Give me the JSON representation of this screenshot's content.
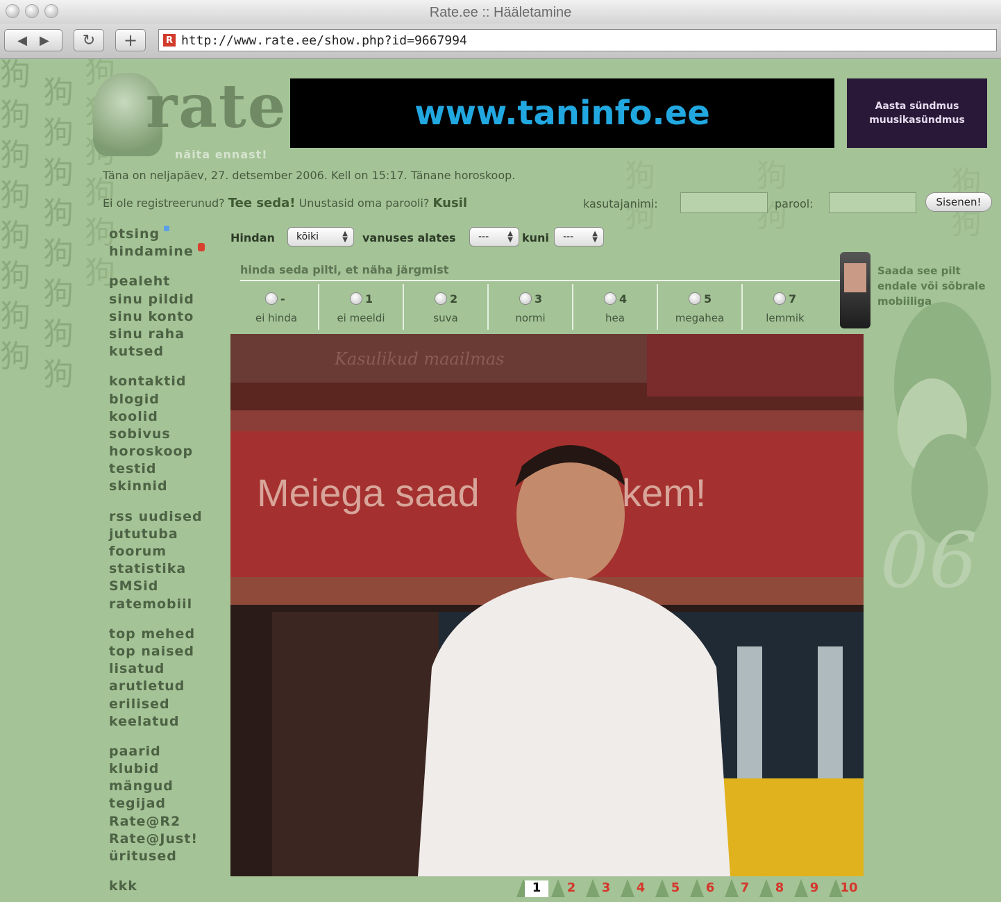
{
  "window": {
    "title": "Rate.ee :: Hääletamine"
  },
  "browser": {
    "url": "http://www.rate.ee/show.php?id=9667994"
  },
  "logo": {
    "text": "rate",
    "tagline": "näita ennast!"
  },
  "banner": {
    "text": "www.taninfo.ee"
  },
  "ad": {
    "line1": "Aasta sündmus",
    "line2": "muusikasündmus"
  },
  "dateline": "Täna on neljapäev, 27. detsember 2006. Kell on 15:17. Tänane horoskoop.",
  "register": {
    "question": "Ei ole registreerunud?",
    "link": "Tee seda!",
    "forgot": "Unustasid oma parooli?",
    "forgot_link": "Kusil",
    "username_label": "kasutajanimi:",
    "password_label": "parool:",
    "login_button": "Sisenen!"
  },
  "nav": {
    "group1": [
      "otsing",
      "hindamine"
    ],
    "group2": [
      "pealeht",
      "sinu pildid",
      "sinu konto",
      "sinu raha",
      "kutsed"
    ],
    "group3": [
      "kontaktid",
      "blogid",
      "koolid",
      "sobivus",
      "horoskoop",
      "testid",
      "skinnid"
    ],
    "group4": [
      "rss uudised",
      "jututuba",
      "foorum",
      "statistika",
      "SMSid",
      "ratemobiil"
    ],
    "group5": [
      "top mehed",
      "top naised",
      "lisatud",
      "arutletud",
      "erilised",
      "keelatud"
    ],
    "group6": [
      "paarid",
      "klubid",
      "mängud",
      "tegijad",
      "Rate@R2",
      "Rate@Just!",
      "üritused"
    ],
    "group7": [
      "kkk"
    ]
  },
  "filter": {
    "label": "Hindan",
    "target": "kõiki",
    "age_from_label": "vanuses alates",
    "age_from": "---",
    "age_to_label": "kuni",
    "age_to": "---"
  },
  "rating": {
    "prompt": "hinda seda pilti, et näha järgmist",
    "options": [
      {
        "num": "-",
        "label": "ei hinda"
      },
      {
        "num": "1",
        "label": "ei meeldi"
      },
      {
        "num": "2",
        "label": "suva"
      },
      {
        "num": "3",
        "label": "normi"
      },
      {
        "num": "4",
        "label": "hea"
      },
      {
        "num": "5",
        "label": "megahea"
      },
      {
        "num": "7",
        "label": "lemmik"
      }
    ]
  },
  "sms_promo": {
    "text": "Saada see pilt endale või sõbrale mobiiliga"
  },
  "photo": {
    "sign_text": "Meiega saad",
    "sign_text_end": "kem!",
    "top_text": "Kasulikud maailmas"
  },
  "pager": {
    "pages": [
      "1",
      "2",
      "3",
      "4",
      "5",
      "6",
      "7",
      "8",
      "9",
      "10"
    ],
    "current": "1"
  },
  "colors": {
    "page_bg": "#a4c396",
    "banner_text": "#22a8e0",
    "pager_text": "#d6362c"
  }
}
